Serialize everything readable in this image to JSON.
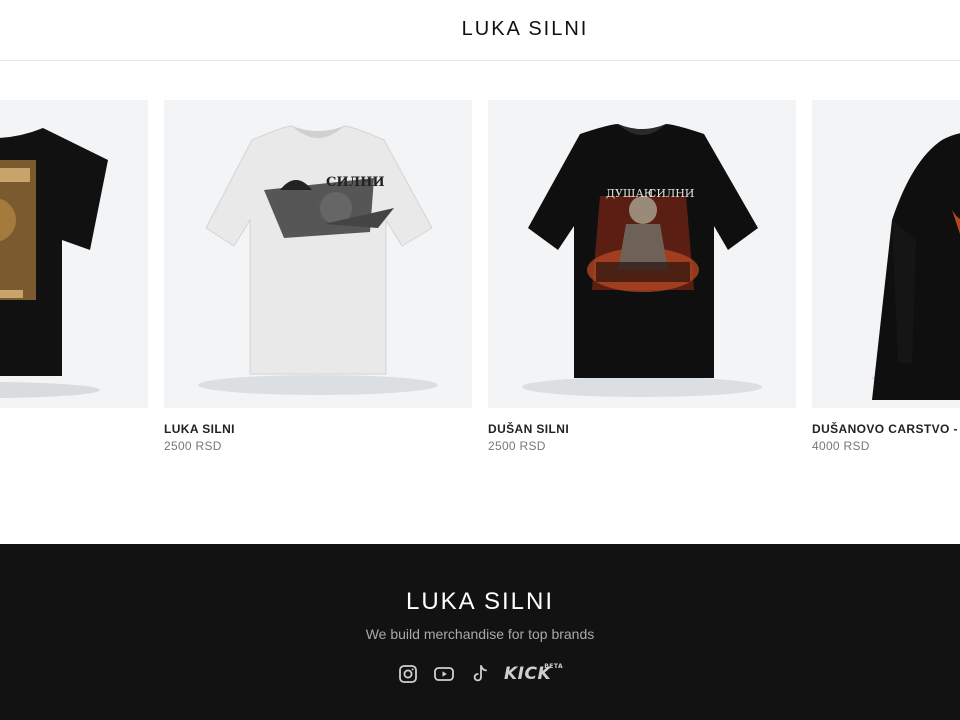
{
  "header": {
    "brand": "LUKA SILNI"
  },
  "products": [
    {
      "name": "",
      "price": "",
      "image": "black-tshirt-icon",
      "print": "warrior-print",
      "visible_text": ""
    },
    {
      "name": "LUKA SILNI",
      "price": "2500 RSD",
      "image": "white-tshirt-icon",
      "print": "knight-print"
    },
    {
      "name": "DUŠAN SILNI",
      "price": "2500 RSD",
      "image": "black-tshirt-icon",
      "print": "tsar-print"
    },
    {
      "name": "DUŠANOVO CARSTVO - D",
      "price": "4000 RSD",
      "image": "black-hoodie-icon",
      "print": "emblem-print"
    }
  ],
  "shirt_text": {
    "luka": "СИЛНИ",
    "dusan_left": "ДУШАН",
    "dusan_right": "СИЛНИ"
  },
  "footer": {
    "brand": "LUKA SILNI",
    "tagline": "We build merchandise for top brands",
    "socials": [
      {
        "icon": "instagram-icon"
      },
      {
        "icon": "youtube-icon"
      },
      {
        "icon": "tiktok-icon"
      },
      {
        "icon": "kick-icon",
        "label": "KICK",
        "sup": "BETA"
      }
    ]
  },
  "colors": {
    "footer_bg": "#121212",
    "card_bg": "#f2f4f6",
    "price": "#777777"
  }
}
